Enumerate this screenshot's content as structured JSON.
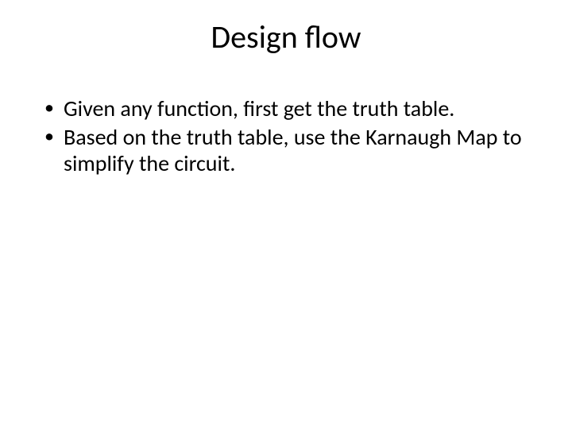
{
  "slide": {
    "title": "Design flow",
    "bullets": [
      "Given any function, first get the truth table.",
      "Based on the truth table, use the Karnaugh Map to simplify the circuit."
    ]
  }
}
